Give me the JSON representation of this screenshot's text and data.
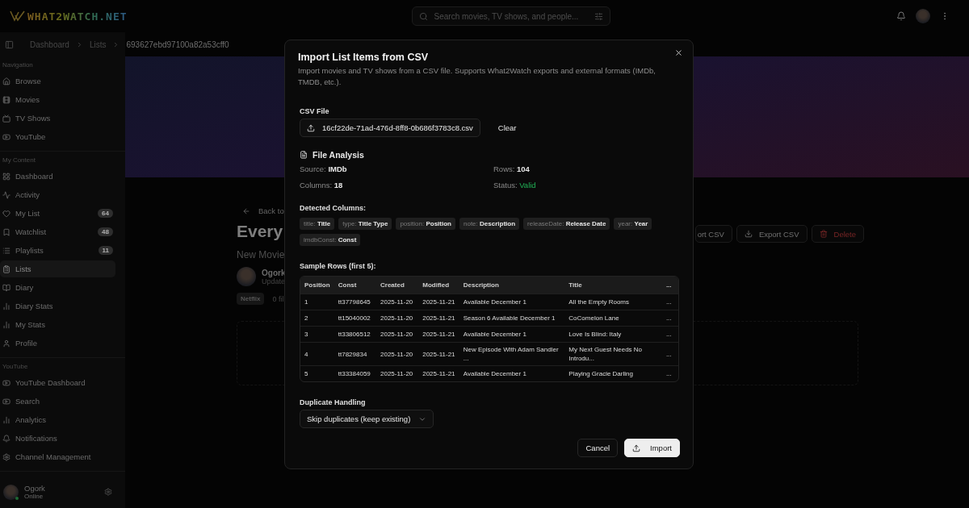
{
  "header": {
    "logo": "WHAT2WATCH.NET",
    "search": {
      "placeholder": "Search movies, TV shows, and people..."
    }
  },
  "breadcrumb": [
    "Dashboard",
    "Lists",
    "693627ebd97100a82a53cff0"
  ],
  "sidebar": {
    "sections": [
      {
        "title": "Navigation",
        "items": [
          {
            "label": "Browse",
            "selected": false
          },
          {
            "label": "Movies",
            "selected": false
          },
          {
            "label": "TV Shows",
            "selected": false
          },
          {
            "label": "YouTube",
            "selected": false
          }
        ]
      },
      {
        "title": "My Content",
        "items": [
          {
            "label": "Dashboard",
            "selected": false
          },
          {
            "label": "Activity",
            "selected": false
          },
          {
            "label": "My List",
            "badge": "64",
            "selected": false
          },
          {
            "label": "Watchlist",
            "badge": "48",
            "selected": false
          },
          {
            "label": "Playlists",
            "badge": "11",
            "selected": false
          },
          {
            "label": "Lists",
            "selected": true
          },
          {
            "label": "Diary",
            "selected": false
          },
          {
            "label": "Diary Stats",
            "selected": false
          },
          {
            "label": "My Stats",
            "selected": false
          },
          {
            "label": "Profile",
            "selected": false
          }
        ]
      },
      {
        "title": "YouTube",
        "items": [
          {
            "label": "YouTube Dashboard",
            "selected": false
          },
          {
            "label": "Search",
            "selected": false
          },
          {
            "label": "Analytics",
            "selected": false
          },
          {
            "label": "Notifications",
            "selected": false
          },
          {
            "label": "Channel Management",
            "selected": false
          }
        ]
      }
    ],
    "user": {
      "name": "Ogork",
      "status": "Online"
    }
  },
  "page": {
    "back": "Back to",
    "title": "Every",
    "subtitle": "New Movie",
    "owner": "Ogork",
    "updated": "Update",
    "tag": "Netflix",
    "count": "0 fil",
    "actions": [
      {
        "label": "ort CSV",
        "kind": "plain"
      },
      {
        "label": "Export CSV",
        "kind": "export"
      },
      {
        "label": "Delete",
        "kind": "danger"
      }
    ]
  },
  "modal": {
    "title": "Import List Items from CSV",
    "description": "Import movies and TV shows from a CSV file. Supports What2Watch exports and external formats (IMDb, TMDB, etc.).",
    "csv_label": "CSV File",
    "file_name": "16cf22de-71ad-476d-8ff8-0b686f3783c8.csv",
    "clear": "Clear",
    "analysis_title": "File Analysis",
    "analysis": [
      {
        "label": "Source:",
        "value": "IMDb",
        "kind": "plain"
      },
      {
        "label": "Rows:",
        "value": "104",
        "kind": "plain"
      },
      {
        "label": "Columns:",
        "value": "18",
        "kind": "plain"
      },
      {
        "label": "Status:",
        "value": "Valid",
        "kind": "valid"
      }
    ],
    "detected_label": "Detected Columns:",
    "detected": [
      {
        "key": "title:",
        "label": "Title"
      },
      {
        "key": "type:",
        "label": "Title Type"
      },
      {
        "key": "position:",
        "label": "Position"
      },
      {
        "key": "note:",
        "label": "Description"
      },
      {
        "key": "releaseDate:",
        "label": "Release Date"
      },
      {
        "key": "year:",
        "label": "Year"
      },
      {
        "key": "imdbConst:",
        "label": "Const"
      }
    ],
    "sample_label": "Sample Rows (first 5):",
    "table": {
      "columns": [
        "Position",
        "Const",
        "Created",
        "Modified",
        "Description",
        "Title",
        "..."
      ],
      "rows": [
        [
          "1",
          "tt37798645",
          "2025-11-20",
          "2025-11-21",
          "Available December 1",
          "All the Empty Rooms",
          "..."
        ],
        [
          "2",
          "tt15040002",
          "2025-11-20",
          "2025-11-21",
          "Season 6 Available December 1",
          "CoComelon Lane",
          "..."
        ],
        [
          "3",
          "tt33806512",
          "2025-11-20",
          "2025-11-21",
          "Available December 1",
          "Love Is Blind: Italy",
          "..."
        ],
        [
          "4",
          "tt7829834",
          "2025-11-20",
          "2025-11-21",
          "New Episode With Adam Sandler ...",
          "My Next Guest Needs No Introdu...",
          "..."
        ],
        [
          "5",
          "tt33384059",
          "2025-11-20",
          "2025-11-21",
          "Available December 1",
          "Playing Gracie Darling",
          "..."
        ]
      ]
    },
    "duplicate_label": "Duplicate Handling",
    "duplicate_value": "Skip duplicates (keep existing)",
    "cancel": "Cancel",
    "import": "Import"
  }
}
